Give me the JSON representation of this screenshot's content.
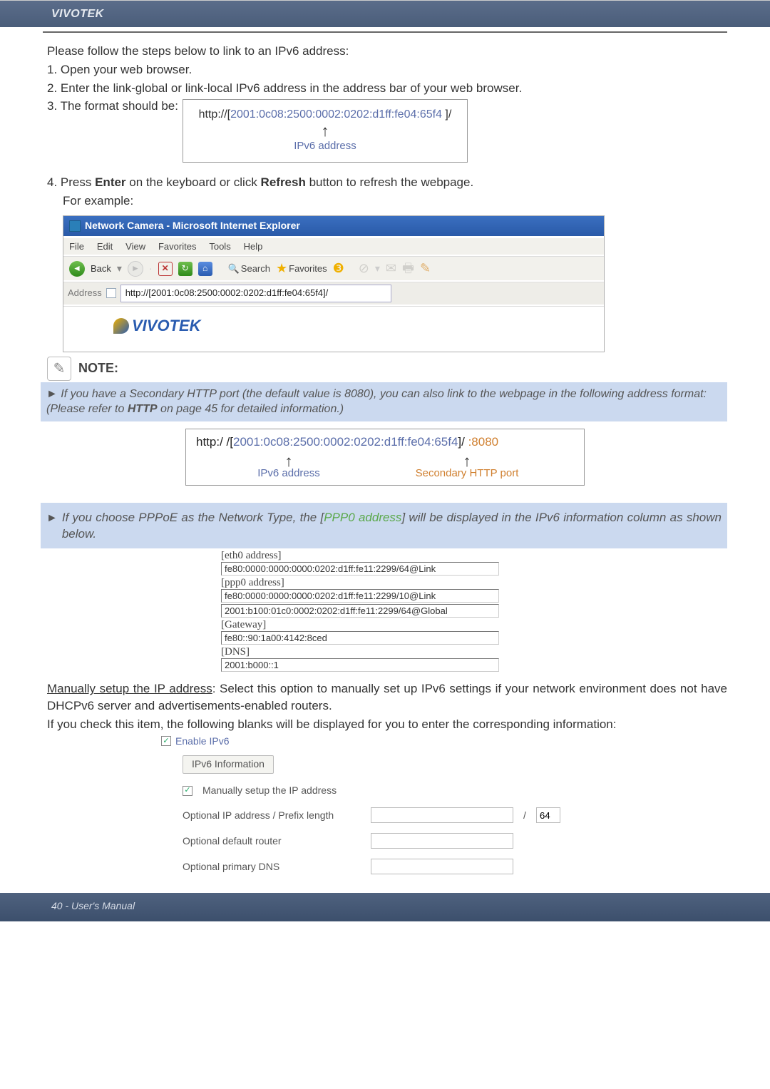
{
  "header": {
    "brand": "VIVOTEK"
  },
  "intro": {
    "line0": "Please follow the steps below to link to an IPv6 address:",
    "step1": "1. Open your web browser.",
    "step2": "2. Enter the link-global or link-local IPv6 address in the address bar of your web browser.",
    "step3": "3. The format should be:"
  },
  "diagram1": {
    "prefix": "http://[",
    "addr": "2001:0c08:2500:0002:0202:d1ff:fe04:65f4",
    "suffix": "   ]/",
    "label": "IPv6 address"
  },
  "step4": {
    "line": "4. Press Enter on the keyboard or click Refresh button to refresh the webpage.",
    "sub": "For example:"
  },
  "ie": {
    "title": "Network Camera - Microsoft Internet Explorer",
    "menu": {
      "file": "File",
      "edit": "Edit",
      "view": "View",
      "favorites": "Favorites",
      "tools": "Tools",
      "help": "Help"
    },
    "tools": {
      "back": "Back",
      "search": "Search",
      "fav": "Favorites"
    },
    "addr_lbl": "Address",
    "addr_val": "http://[2001:0c08:2500:0002:0202:d1ff:fe04:65f4]/",
    "logo": "VIVOTEK"
  },
  "note": {
    "title": "NOTE:"
  },
  "note_box": {
    "text": "If you have a Secondary HTTP port (the default value is 8080), you can also link to the webpage in the following address format: (Please refer to HTTP on page 45 for detailed information.)"
  },
  "diagram2": {
    "prefix": "http:/ /[",
    "addr": "2001:0c08:2500:0002:0202:d1ff:fe04:65f4",
    "mid": "]/ ",
    "port": ":8080",
    "label_ip": "IPv6 address",
    "label_port": "Secondary HTTP port"
  },
  "pppoe": {
    "text_a": "If you choose PPPoE as the Network Type, the [",
    "text_green": "PPP0 address",
    "text_b": "] will be displayed in the IPv6 information column as shown below."
  },
  "info": {
    "eth_hdr": "[eth0 address]",
    "eth_val": "fe80:0000:0000:0000:0202:d1ff:fe11:2299/64@Link",
    "ppp_hdr": "[ppp0 address]",
    "ppp_val1": "fe80:0000:0000:0000:0202:d1ff:fe11:2299/10@Link",
    "ppp_val2": "2001:b100:01c0:0002:0202:d1ff:fe11:2299/64@Global",
    "gw_hdr": "[Gateway]",
    "gw_val": "fe80::90:1a00:4142:8ced",
    "dns_hdr": "[DNS]",
    "dns_val": "2001:b000::1"
  },
  "manual": {
    "u": "Manually setup the IP address",
    "rest1": ": Select this option to manually set up IPv6 settings if your network environment does not have DHCPv6 server and advertisements-enabled routers.",
    "rest2": "If you check this item, the following blanks will be displayed for you to enter the corresponding information:"
  },
  "ipv6cfg": {
    "enable": "Enable IPv6",
    "info_btn": "IPv6 Information",
    "manual_chk": "Manually setup the IP address",
    "row1": "Optional IP address / Prefix length",
    "prefix_val": "64",
    "row2": "Optional default router",
    "row3": "Optional primary DNS"
  },
  "footer": {
    "pg": "40 - User's Manual"
  }
}
